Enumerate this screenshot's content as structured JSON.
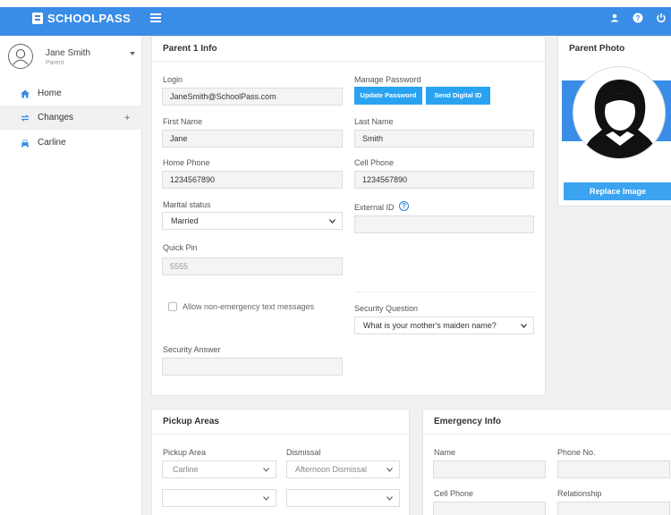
{
  "app": {
    "brand": "SCHOOLPASS"
  },
  "user": {
    "name": "Jane Smith",
    "role": "Parent"
  },
  "sidebar": {
    "items": [
      {
        "label": "Home"
      },
      {
        "label": "Changes",
        "expand": "+"
      },
      {
        "label": "Carline"
      }
    ]
  },
  "parent_info": {
    "title": "Parent 1 Info",
    "login_label": "Login",
    "login_value": "JaneSmith@SchoolPass.com",
    "manage_password_label": "Manage Password",
    "update_password_button": "Update Password",
    "send_digital_id_button": "Send Digital ID",
    "first_name_label": "First Name",
    "first_name_value": "Jane",
    "last_name_label": "Last Name",
    "last_name_value": "Smith",
    "home_phone_label": "Home Phone",
    "home_phone_value": "1234567890",
    "cell_phone_label": "Cell Phone",
    "cell_phone_value": "1234567890",
    "marital_status_label": "Marital status",
    "marital_status_value": "Married",
    "external_id_label": "External ID",
    "external_id_value": "",
    "quick_pin_label": "Quick Pin",
    "quick_pin_value": "5555",
    "allow_texts_label": "Allow non-emergency text messages",
    "security_question_label": "Security Question",
    "security_question_value": "What is your mother's maiden name?",
    "security_answer_label": "Security Answer",
    "security_answer_value": ""
  },
  "parent_photo": {
    "title": "Parent Photo",
    "replace_button": "Replace Image"
  },
  "pickup": {
    "title": "Pickup Areas",
    "pickup_area_label": "Pickup Area",
    "dismissal_label": "Dismissal",
    "row1_area": "Carline",
    "row1_dismissal": "Afternoon Dismissal",
    "row2_area": "",
    "row2_dismissal": ""
  },
  "emergency": {
    "title": "Emergency Info",
    "name_label": "Name",
    "phone_label": "Phone No.",
    "cell_label": "Cell Phone",
    "relationship_label": "Relationship"
  },
  "colors": {
    "accent": "#3a8de6",
    "button": "#29a3f1",
    "help": "#2a7fe2"
  },
  "icons": [
    "logo-icon",
    "menu-icon",
    "user-icon",
    "help-icon",
    "power-icon",
    "home-icon",
    "changes-icon",
    "car-icon",
    "chevron-down-icon"
  ]
}
